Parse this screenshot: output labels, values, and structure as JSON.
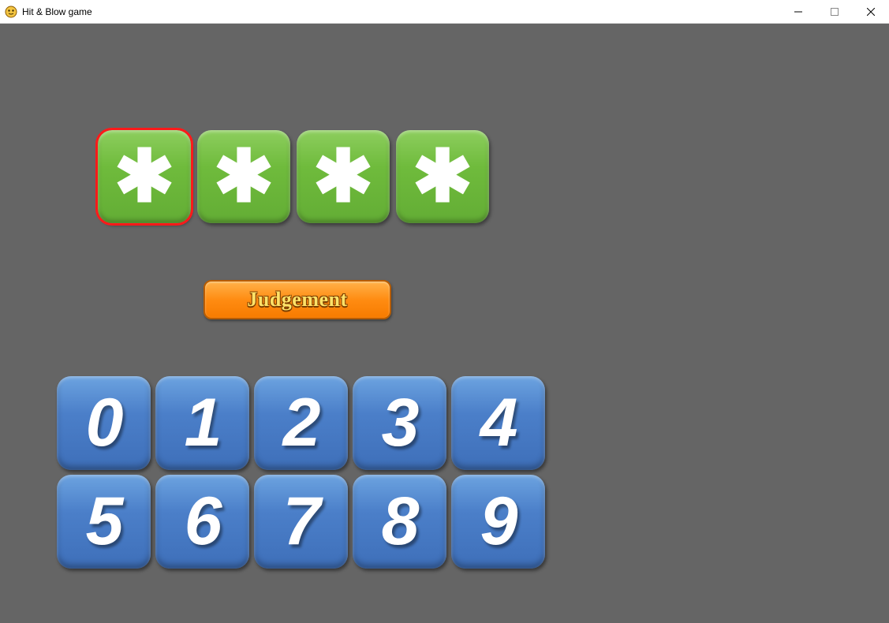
{
  "window": {
    "title": "Hit & Blow game"
  },
  "slots": [
    {
      "value": "✱",
      "selected": true
    },
    {
      "value": "✱",
      "selected": false
    },
    {
      "value": "✱",
      "selected": false
    },
    {
      "value": "✱",
      "selected": false
    }
  ],
  "judge_button": {
    "label": "Judgement"
  },
  "numpad": {
    "row1": [
      "0",
      "1",
      "2",
      "3",
      "4"
    ],
    "row2": [
      "5",
      "6",
      "7",
      "8",
      "9"
    ]
  }
}
